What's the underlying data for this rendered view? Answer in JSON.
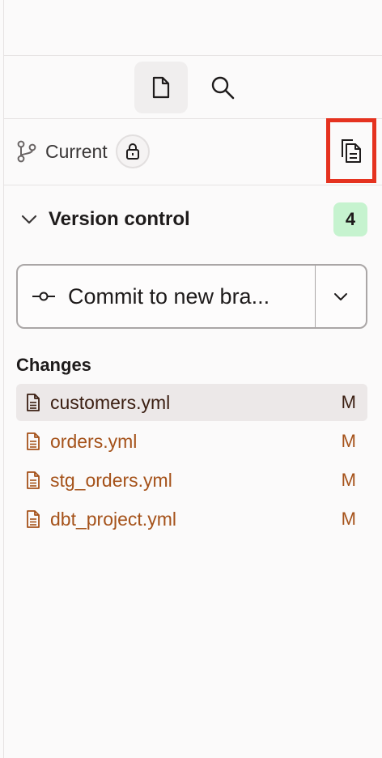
{
  "toolbar": {
    "tabs": [
      {
        "icon": "file-icon",
        "active": true
      },
      {
        "icon": "search-icon",
        "active": false
      }
    ]
  },
  "branch": {
    "label": "Current",
    "icon": "git-branch-icon",
    "lock_icon": "lock-icon",
    "copy_icon": "copy-icon"
  },
  "version_control": {
    "title": "Version control",
    "count": "4",
    "badge_color": "#c6f3cf",
    "commit_label": "Commit to new bra...",
    "commit_icon": "git-commit-icon",
    "dropdown_icon": "chevron-down-icon"
  },
  "changes": {
    "title": "Changes",
    "files": [
      {
        "name": "customers.yml",
        "status": "M",
        "selected": true
      },
      {
        "name": "orders.yml",
        "status": "M",
        "selected": false
      },
      {
        "name": "stg_orders.yml",
        "status": "M",
        "selected": false
      },
      {
        "name": "dbt_project.yml",
        "status": "M",
        "selected": false
      }
    ],
    "modified_color": "#a5521a",
    "highlight_color": "#e5321f"
  }
}
